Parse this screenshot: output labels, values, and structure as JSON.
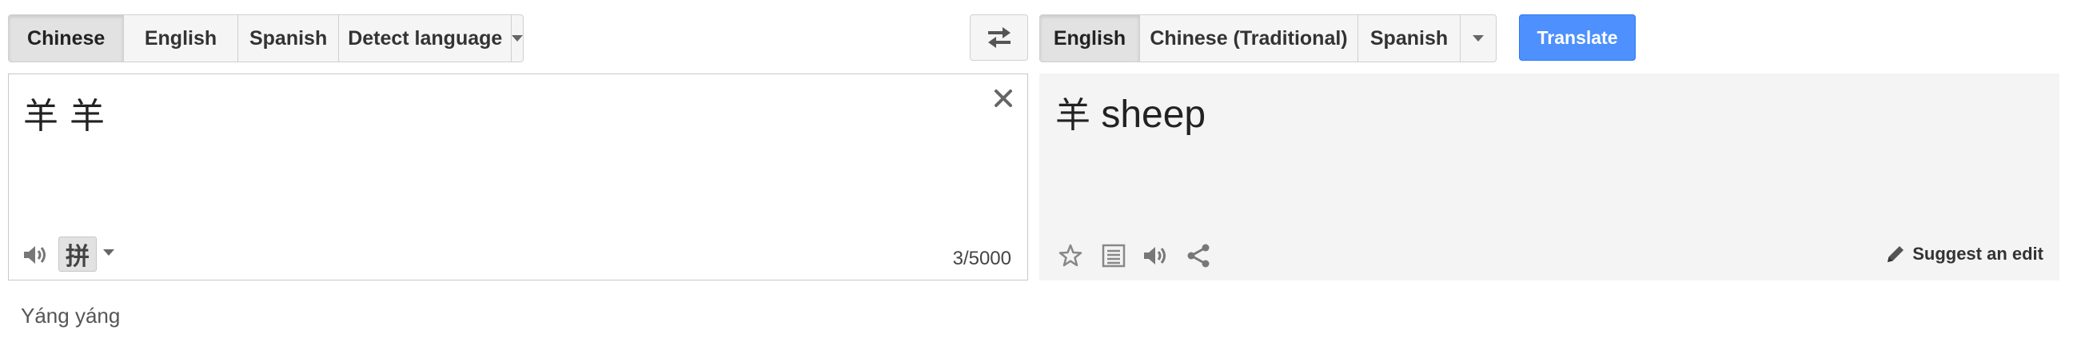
{
  "source_languages": {
    "items": [
      "Chinese",
      "English",
      "Spanish",
      "Detect language"
    ],
    "active_index": 0
  },
  "target_languages": {
    "items": [
      "English",
      "Chinese (Traditional)",
      "Spanish"
    ],
    "active_index": 0
  },
  "translate_button": {
    "label": "Translate"
  },
  "source": {
    "text": "羊 羊",
    "char_count": "3/5000",
    "input_method_glyph": "拼",
    "romanization": "Yáng yáng"
  },
  "result": {
    "han": "羊",
    "text": "sheep",
    "suggest_edit_label": "Suggest an edit"
  },
  "colors": {
    "accent": "#4d90fe",
    "panel_bg": "#f4f4f4",
    "icon": "#777777"
  },
  "icons": {
    "swap": "swap-arrows-icon",
    "clear": "close-icon",
    "listen": "speaker-icon",
    "star": "star-icon",
    "dictionary": "list-icon",
    "share": "share-icon",
    "edit": "pencil-icon"
  }
}
